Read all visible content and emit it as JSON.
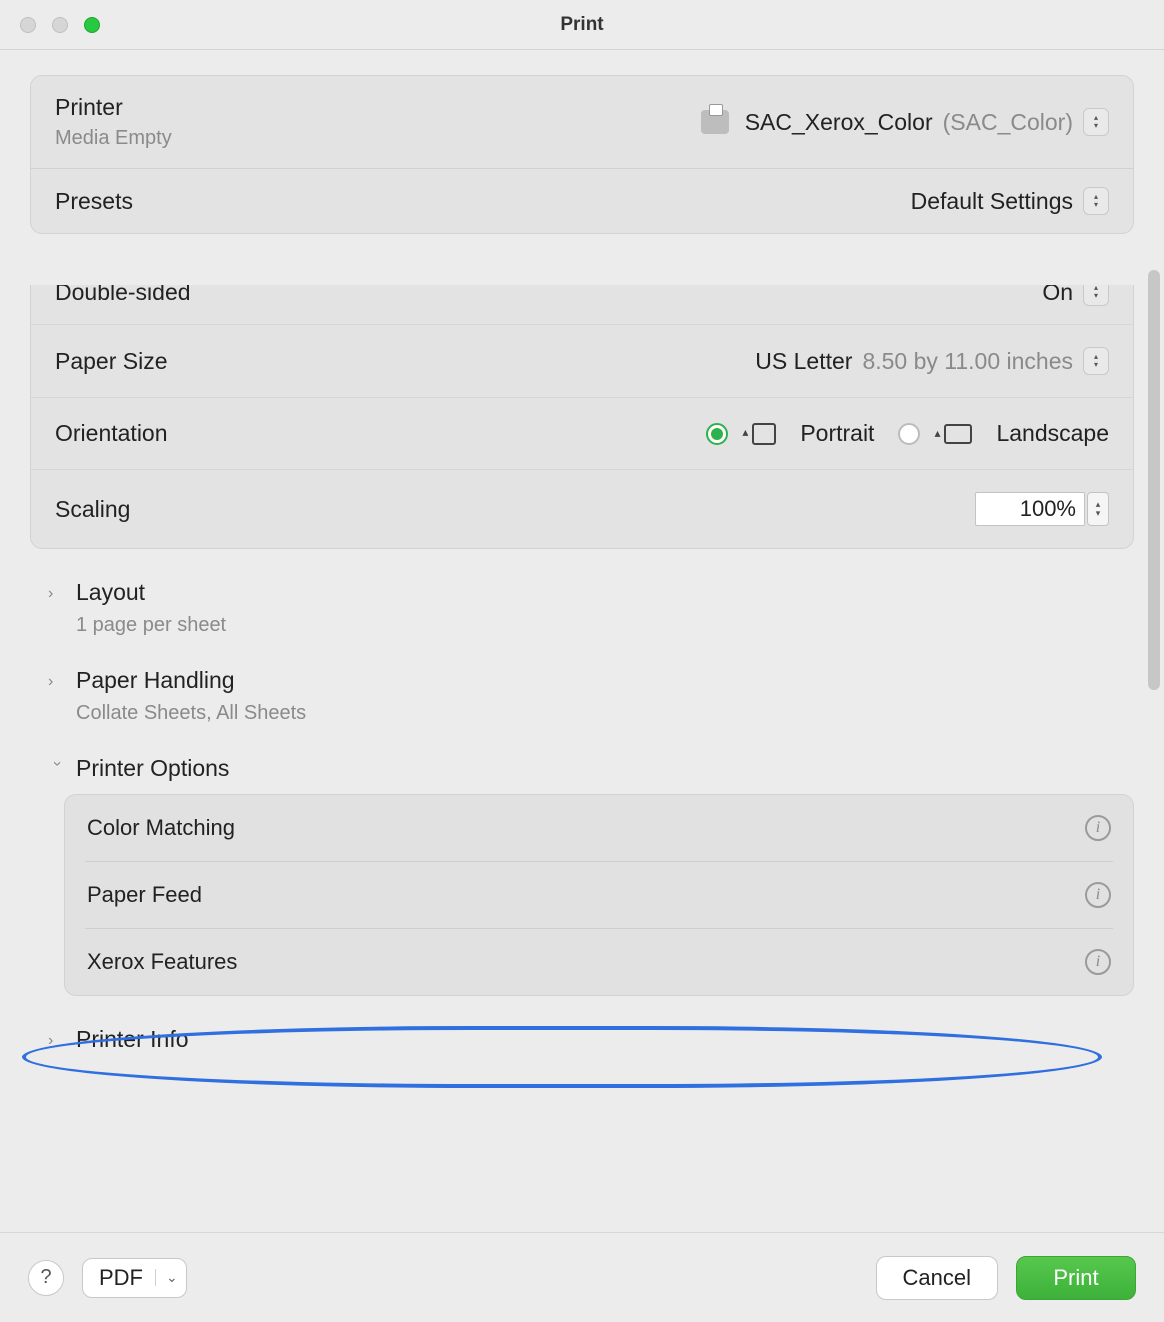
{
  "window": {
    "title": "Print"
  },
  "header": {
    "printer_label": "Printer",
    "printer_name": "SAC_Xerox_Color",
    "printer_paren": "(SAC_Color)",
    "printer_status": "Media Empty",
    "presets_label": "Presets",
    "presets_value": "Default Settings"
  },
  "settings": {
    "double_sided_label": "Double-sided",
    "double_sided_value": "On",
    "paper_size_label": "Paper Size",
    "paper_size_value": "US Letter",
    "paper_size_dims": "8.50 by 11.00 inches",
    "orientation_label": "Orientation",
    "orientation_portrait": "Portrait",
    "orientation_landscape": "Landscape",
    "orientation_selected": "portrait",
    "scaling_label": "Scaling",
    "scaling_value": "100%"
  },
  "sections": {
    "layout": {
      "title": "Layout",
      "sub": "1 page per sheet"
    },
    "paper_handling": {
      "title": "Paper Handling",
      "sub": "Collate Sheets, All Sheets"
    },
    "printer_options": {
      "title": "Printer Options",
      "items": [
        {
          "label": "Color Matching"
        },
        {
          "label": "Paper Feed"
        },
        {
          "label": "Xerox Features"
        }
      ]
    },
    "printer_info": {
      "title": "Printer Info"
    }
  },
  "footer": {
    "help": "?",
    "pdf_label": "PDF",
    "cancel": "Cancel",
    "print": "Print"
  }
}
